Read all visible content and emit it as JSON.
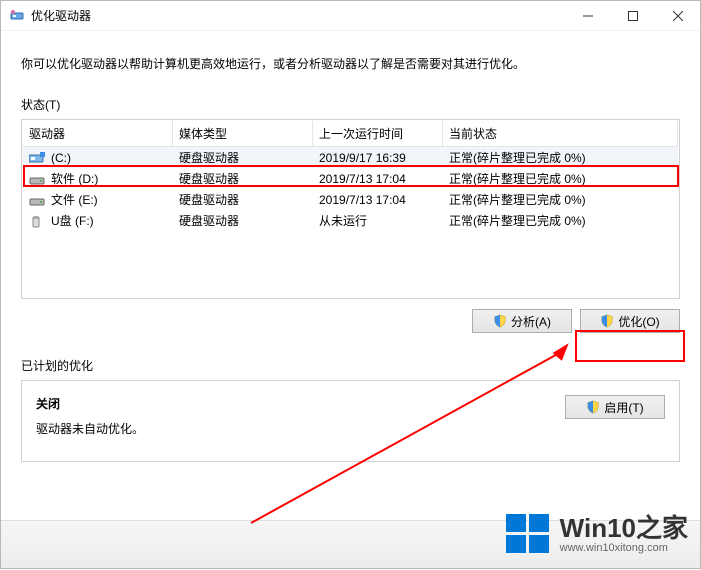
{
  "window": {
    "title": "优化驱动器"
  },
  "description": "你可以优化驱动器以帮助计算机更高效地运行，或者分析驱动器以了解是否需要对其进行优化。",
  "status_label": "状态(T)",
  "table": {
    "headers": {
      "drive": "驱动器",
      "media": "媒体类型",
      "last_run": "上一次运行时间",
      "current": "当前状态"
    },
    "rows": [
      {
        "icon": "drive-c",
        "drive": "(C:)",
        "media": "硬盘驱动器",
        "last": "2019/9/17 16:39",
        "status": "正常(碎片整理已完成 0%)",
        "selected": true
      },
      {
        "icon": "drive-hdd",
        "drive": "软件 (D:)",
        "media": "硬盘驱动器",
        "last": "2019/7/13 17:04",
        "status": "正常(碎片整理已完成 0%)"
      },
      {
        "icon": "drive-hdd",
        "drive": "文件 (E:)",
        "media": "硬盘驱动器",
        "last": "2019/7/13 17:04",
        "status": "正常(碎片整理已完成 0%)"
      },
      {
        "icon": "drive-usb",
        "drive": "U盘 (F:)",
        "media": "硬盘驱动器",
        "last": "从未运行",
        "status": "正常(碎片整理已完成 0%)"
      }
    ]
  },
  "buttons": {
    "analyze": "分析(A)",
    "optimize": "优化(O)",
    "enable": "启用(T)"
  },
  "scheduled": {
    "label": "已计划的优化",
    "title": "关闭",
    "text": "驱动器未自动优化。"
  },
  "watermark": {
    "brand": "Win10之家",
    "url": "www.win10xitong.com"
  }
}
